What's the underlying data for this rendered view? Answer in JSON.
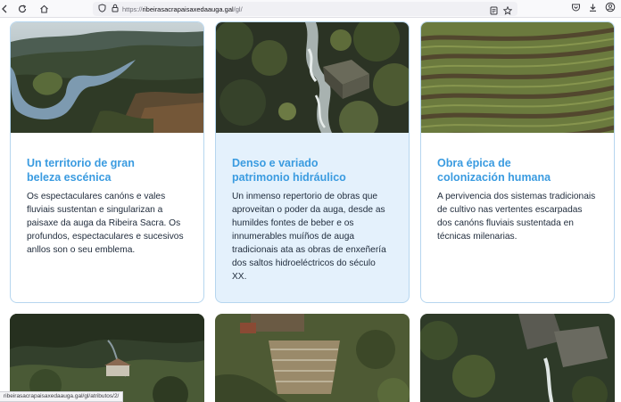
{
  "browser": {
    "url_prefix": "https://",
    "url_host": "ribeirasacrapaisaxedaauga.gal",
    "url_path": "/gl/",
    "status_url": "ribeirasacrapaisaxedaauga.gal/gl/atributos/2/"
  },
  "cards": [
    {
      "title": "Un territorio de gran\nbeleza escénica",
      "description": "Os espectaculares canóns e vales fluviais sustentan e singularizan a paisaxe da auga da Ribeira Sacra. Os profundos, espectaculares e sucesivos anllos son o seu emblema."
    },
    {
      "title": "Denso e variado\npatrimonio hidráulico",
      "description": "Un inmenso repertorio de obras que aproveitan o poder da auga, desde as humildes fontes de beber e os innumerables muíños de auga tradicionais ata as obras de enxeñería dos saltos hidroeléctricos do século XX."
    },
    {
      "title": "Obra épica de\ncolonización humana",
      "description": "A pervivencia dos sistemas tradicionais de cultivo nas vertentes escarpadas dos canóns fluviais sustentada en técnicas milenarias."
    }
  ],
  "colors": {
    "title": "#3a9be0",
    "card_border": "#b6d6ef",
    "card_highlight_bg": "#e4f1fc",
    "text": "#1e2a3a"
  },
  "icons": [
    "back-arrow-icon",
    "reload-icon",
    "home-icon",
    "shield-icon",
    "lock-icon",
    "reader-view-icon",
    "bookmark-star-icon",
    "pocket-icon",
    "downloads-icon",
    "account-icon"
  ]
}
